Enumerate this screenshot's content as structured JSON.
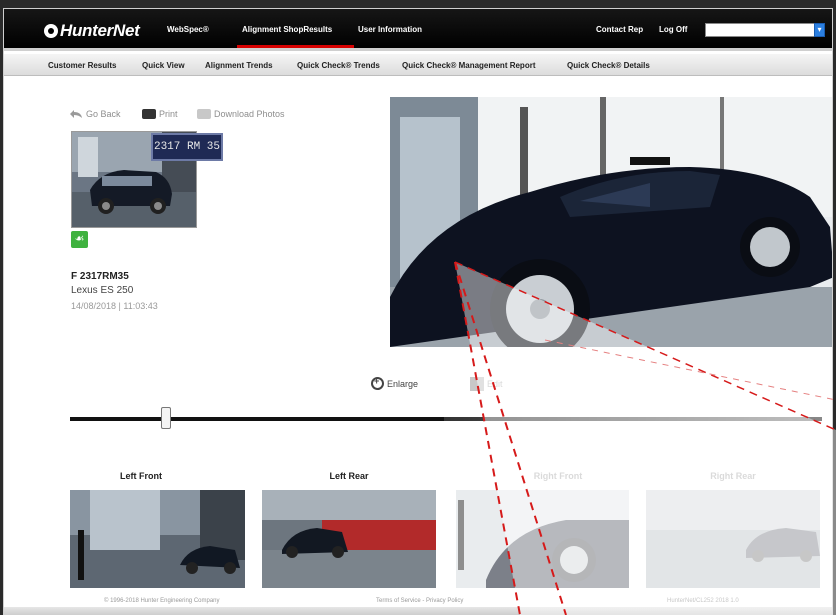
{
  "header": {
    "logo": "HunterNet",
    "nav": [
      {
        "label": "WebSpec®"
      },
      {
        "label": "Alignment ShopResults"
      },
      {
        "label": "User Information"
      }
    ],
    "contact_rep": "Contact Rep",
    "log_off": "Log Off",
    "search_value": ""
  },
  "subnav": [
    {
      "label": "Customer Results"
    },
    {
      "label": "Quick View"
    },
    {
      "label": "Alignment Trends"
    },
    {
      "label": "Quick Check® Trends"
    },
    {
      "label": "Quick Check® Management Report"
    },
    {
      "label": "Quick Check® Details"
    }
  ],
  "toolbar": {
    "go_back": "Go Back",
    "print": "Print",
    "download_photos": "Download Photos"
  },
  "vehicle": {
    "plate_tag": "2317 RM 35",
    "plate": "F 2317RM35",
    "model": "Lexus ES 250",
    "date": "14/08/2018",
    "time": "11:03:43",
    "date_line": "14/08/2018  |  11:03:43"
  },
  "controls": {
    "enlarge": "Enlarge",
    "edit": "Edit",
    "slider_position": 0.13
  },
  "thumbnails": [
    {
      "label": "Left Front"
    },
    {
      "label": "Left Rear"
    },
    {
      "label": "Right Front"
    },
    {
      "label": "Right Rear"
    }
  ],
  "footer": {
    "copyright": "© 1996-2018 Hunter Engineering Company",
    "terms": "Terms of Service - Privacy Policy",
    "version": "HunterNet/CL252 2018 1.0"
  },
  "colors": {
    "nav_active_underline": "#d60000",
    "badge_green": "#3fb23f",
    "search_button": "#2b7fe0"
  },
  "icons": [
    "logo-mark-icon",
    "go-back-icon",
    "print-icon",
    "download-photos-icon",
    "search-button-icon",
    "alignment-badge-icon",
    "enlarge-icon",
    "edit-icon"
  ]
}
